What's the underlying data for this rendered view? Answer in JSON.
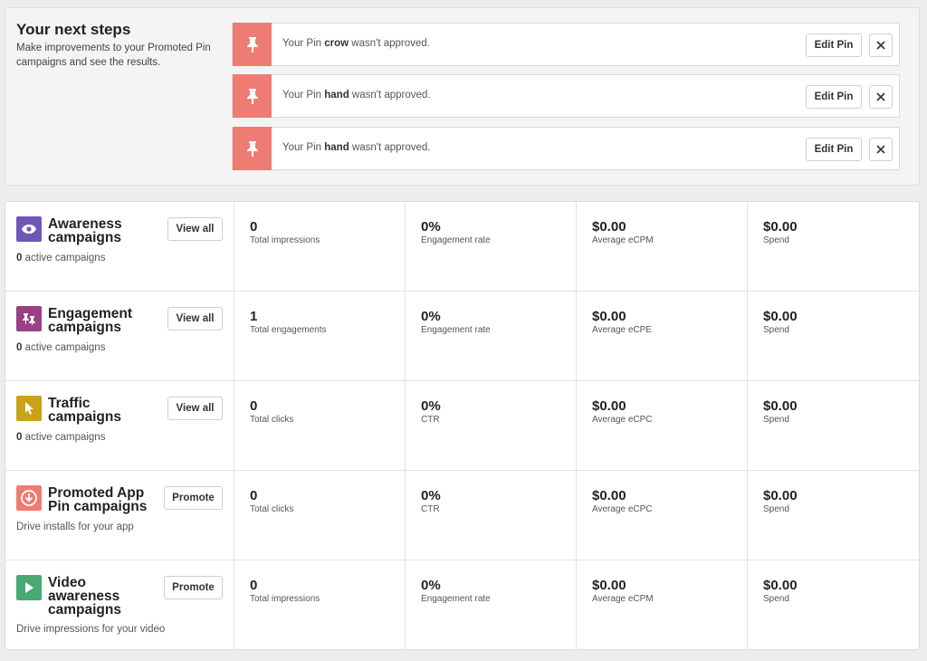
{
  "next_steps": {
    "title": "Your next steps",
    "description": "Make improvements to your Promoted Pin campaigns and see the results.",
    "notifications": [
      {
        "prefix": "Your Pin ",
        "pin_name": "crow",
        "suffix": " wasn't approved.",
        "edit_label": "Edit Pin"
      },
      {
        "prefix": "Your Pin ",
        "pin_name": "hand",
        "suffix": " wasn't approved.",
        "edit_label": "Edit Pin"
      },
      {
        "prefix": "Your Pin ",
        "pin_name": "hand",
        "suffix": " wasn't approved.",
        "edit_label": "Edit Pin"
      }
    ]
  },
  "campaigns": [
    {
      "name": "Awareness campaigns",
      "icon": "eye-icon",
      "icon_color": "#6e57b5",
      "sub_count": "0",
      "sub_text": " active campaigns",
      "action_label": "View all",
      "metrics": [
        {
          "value": "0",
          "label": "Total impressions"
        },
        {
          "value": "0%",
          "label": "Engagement rate"
        },
        {
          "value": "$0.00",
          "label": "Average eCPM"
        },
        {
          "value": "$0.00",
          "label": "Spend"
        }
      ]
    },
    {
      "name": "Engagement campaigns",
      "icon": "engagement-pin-icon",
      "icon_color": "#9b3f87",
      "sub_count": "0",
      "sub_text": " active campaigns",
      "action_label": "View all",
      "metrics": [
        {
          "value": "1",
          "label": "Total engagements"
        },
        {
          "value": "0%",
          "label": "Engagement rate"
        },
        {
          "value": "$0.00",
          "label": "Average eCPE"
        },
        {
          "value": "$0.00",
          "label": "Spend"
        }
      ]
    },
    {
      "name": "Traffic campaigns",
      "icon": "cursor-icon",
      "icon_color": "#c9a21a",
      "sub_count": "0",
      "sub_text": " active campaigns",
      "action_label": "View all",
      "metrics": [
        {
          "value": "0",
          "label": "Total clicks"
        },
        {
          "value": "0%",
          "label": "CTR"
        },
        {
          "value": "$0.00",
          "label": "Average eCPC"
        },
        {
          "value": "$0.00",
          "label": "Spend"
        }
      ]
    },
    {
      "name": "Promoted App Pin campaigns",
      "icon": "download-icon",
      "icon_color": "#ef7c72",
      "sub_count": "",
      "sub_text": "Drive installs for your app",
      "action_label": "Promote",
      "metrics": [
        {
          "value": "0",
          "label": "Total clicks"
        },
        {
          "value": "0%",
          "label": "CTR"
        },
        {
          "value": "$0.00",
          "label": "Average eCPC"
        },
        {
          "value": "$0.00",
          "label": "Spend"
        }
      ]
    },
    {
      "name": "Video awareness campaigns",
      "icon": "play-icon",
      "icon_color": "#4aa873",
      "sub_count": "",
      "sub_text": "Drive impressions for your video",
      "action_label": "Promote",
      "metrics": [
        {
          "value": "0",
          "label": "Total impressions"
        },
        {
          "value": "0%",
          "label": "Engagement rate"
        },
        {
          "value": "$0.00",
          "label": "Average eCPM"
        },
        {
          "value": "$0.00",
          "label": "Spend"
        }
      ]
    }
  ]
}
